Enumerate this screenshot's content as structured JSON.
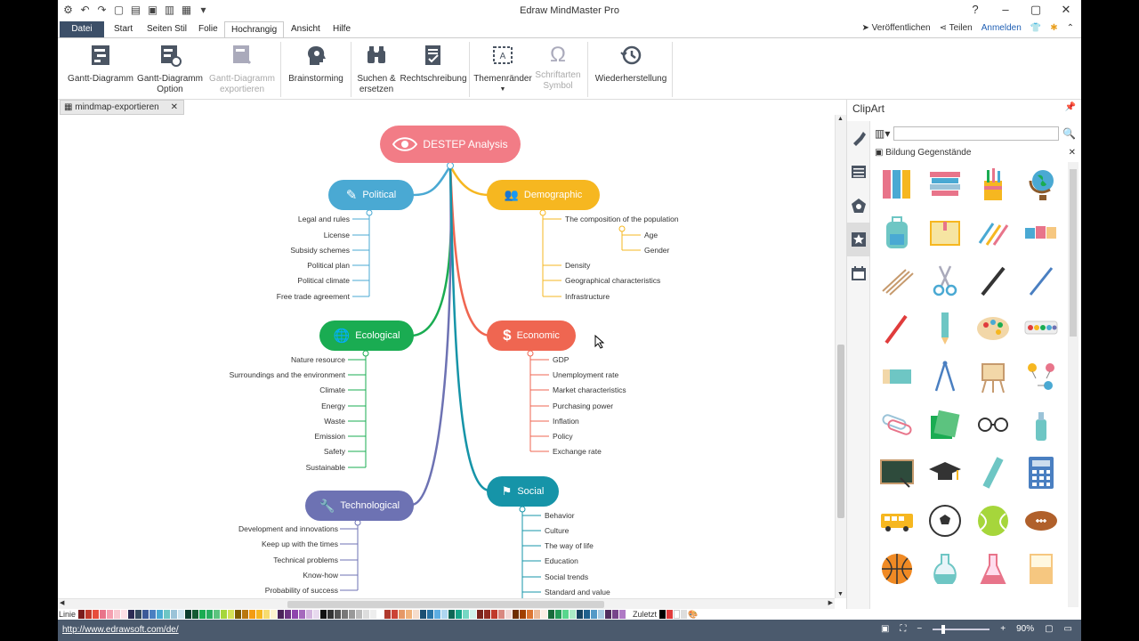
{
  "app": {
    "title": "Edraw MindMaster Pro",
    "menu": [
      "Datei",
      "Start",
      "Seiten Stil",
      "Folie",
      "Hochrangig",
      "Ansicht",
      "Hilfe"
    ],
    "publish": "Veröffentlichen",
    "share": "Teilen",
    "login": "Anmelden"
  },
  "ribbon": {
    "gantt": "Gantt-Diagramm",
    "gantt_option": "Gantt-Diagramm Option",
    "gantt_export": "Gantt-Diagramm exportieren",
    "brainstorm": "Brainstorming",
    "search": "Suchen & ersetzen",
    "spelling": "Rechtschreibung",
    "themes": "Themenränder",
    "symbols": "Schriftarten Symbol",
    "recovery": "Wiederherstellung"
  },
  "doc_tab": "mindmap-exportieren",
  "mindmap": {
    "central": "DESTEP Analysis",
    "political": {
      "label": "Political",
      "items": [
        "Legal and rules",
        "License",
        "Subsidy schemes",
        "Political plan",
        "Political climate",
        "Free trade agreement"
      ]
    },
    "demographic": {
      "label": "Demographic",
      "items": [
        "The composition of the population",
        "Age",
        "Gender",
        "Density",
        "Geographical characteristics",
        "Infrastructure"
      ]
    },
    "ecological": {
      "label": "Ecological",
      "items": [
        "Nature resource",
        "Surroundings and the environment",
        "Climate",
        "Energy",
        "Waste",
        "Emission",
        "Safety",
        "Sustainable"
      ]
    },
    "economic": {
      "label": "Economic",
      "items": [
        "GDP",
        "Unemployment rate",
        "Market characteristics",
        "Purchasing power",
        "Inflation",
        "Policy",
        "Exchange rate"
      ]
    },
    "technological": {
      "label": "Technological",
      "items": [
        "Development and innovations",
        "Keep up with the times",
        "Technical problems",
        "Know-how",
        "Probability of success"
      ]
    },
    "social": {
      "label": "Social",
      "items": [
        "Behavior",
        "Culture",
        "The way of life",
        "Education",
        "Social trends",
        "Standard and value"
      ]
    }
  },
  "clipart": {
    "title": "ClipArt",
    "category": "Bildung Gegenstände",
    "search_value": ""
  },
  "colorbar": {
    "line_label": "Linie",
    "fill_label": "Zuletzt"
  },
  "status": {
    "url": "http://www.edrawsoft.com/de/",
    "zoom": "90%"
  },
  "colors": {
    "file_tab": "#3c4f68",
    "central": "#f27c86",
    "political": "#4aa9d3",
    "demographic": "#f6b720",
    "ecological": "#1aac52",
    "economic": "#ef6651",
    "technological": "#6d72b3",
    "social": "#1694a8",
    "status_bar": "#4b5a6d"
  }
}
